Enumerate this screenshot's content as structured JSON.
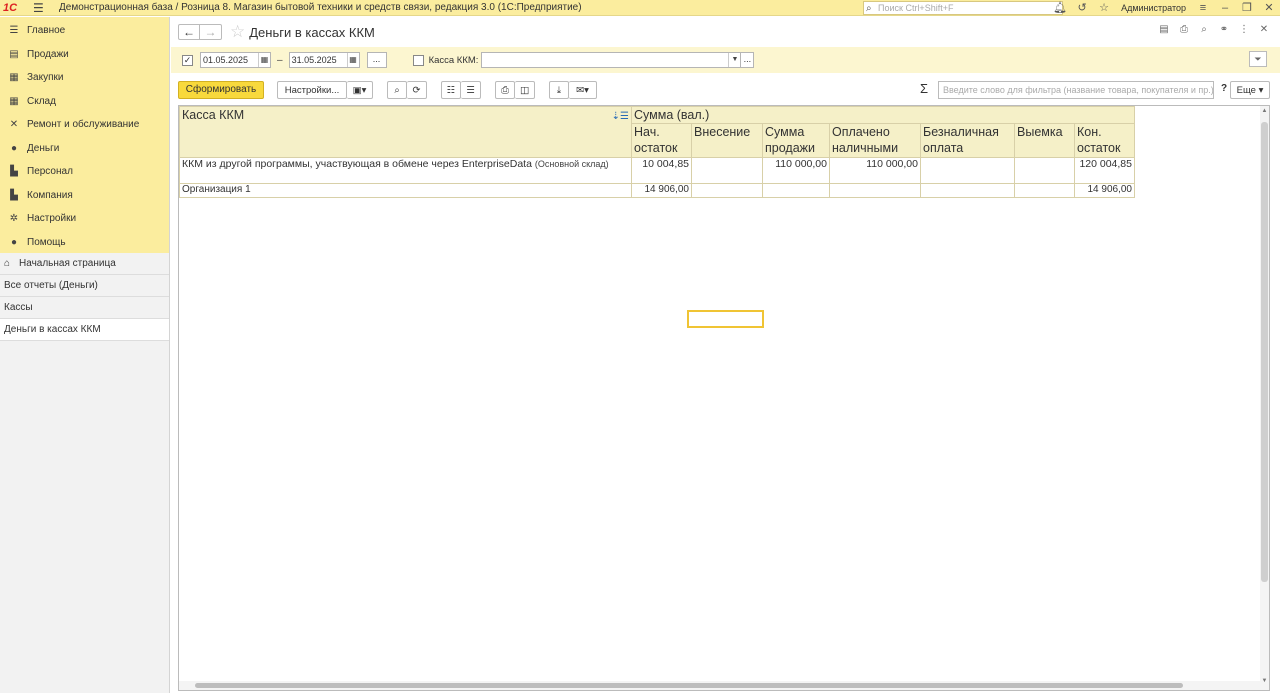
{
  "titlebar": {
    "logo": "1С",
    "title": "Демонстрационная база / Розница 8. Магазин бытовой техники и средств связи, редакция 3.0  (1С:Предприятие)",
    "search_placeholder": "Поиск Ctrl+Shift+F",
    "user": "Администратор"
  },
  "sidebar": {
    "sections": [
      {
        "label": "Главное",
        "icon": "menu-lines-icon"
      },
      {
        "label": "Продажи",
        "icon": "cart-icon"
      },
      {
        "label": "Закупки",
        "icon": "truck-icon"
      },
      {
        "label": "Склад",
        "icon": "grid-icon"
      },
      {
        "label": "Ремонт и обслуживание",
        "icon": "wrench-icon"
      },
      {
        "label": "Деньги",
        "icon": "coin-icon"
      },
      {
        "label": "Персонал",
        "icon": "person-icon"
      },
      {
        "label": "Компания",
        "icon": "building-icon"
      },
      {
        "label": "Настройки",
        "icon": "gear-icon"
      },
      {
        "label": "Помощь",
        "icon": "help-icon"
      }
    ],
    "open_windows": [
      {
        "label": "Начальная страница"
      },
      {
        "label": "Все отчеты (Деньги)"
      },
      {
        "label": "Кассы"
      },
      {
        "label": "Деньги в кассах ККМ"
      }
    ]
  },
  "header": {
    "title": "Деньги в кассах ККМ"
  },
  "params": {
    "date_from": "01.05.2025",
    "date_to": "31.05.2025",
    "dash": "–",
    "period_dots": "...",
    "kkm_label": "Касса ККМ:",
    "kkm_value": "",
    "kkm_dots": "..."
  },
  "toolbar": {
    "generate_label": "Сформировать",
    "settings_label": "Настройки...",
    "sigma": "Σ",
    "filter_placeholder": "Введите слово для фильтра (название товара, покупателя и пр.)",
    "help_mark": "?",
    "more_label": "Еще"
  },
  "report": {
    "col_group_left": "Касса ККМ",
    "col_group_sum": "Сумма (вал.)",
    "columns": [
      "Нач. остаток",
      "Внесение",
      "Сумма продажи",
      "Оплачено наличными",
      "Безналичная оплата",
      "Выемка",
      "Кон. остаток"
    ],
    "rows": [
      {
        "name": "ККМ из другой программы, участвующая в обмене через EnterpriseData",
        "sub": "(Основной склад)",
        "values": [
          "10 004,85",
          "",
          "110 000,00",
          "110 000,00",
          "",
          "",
          "120 004,85"
        ]
      },
      {
        "name": "Организация 1",
        "sub": "",
        "values": [
          "14 906,00",
          "",
          "",
          "",
          "",
          "",
          "14 906,00"
        ]
      }
    ]
  }
}
